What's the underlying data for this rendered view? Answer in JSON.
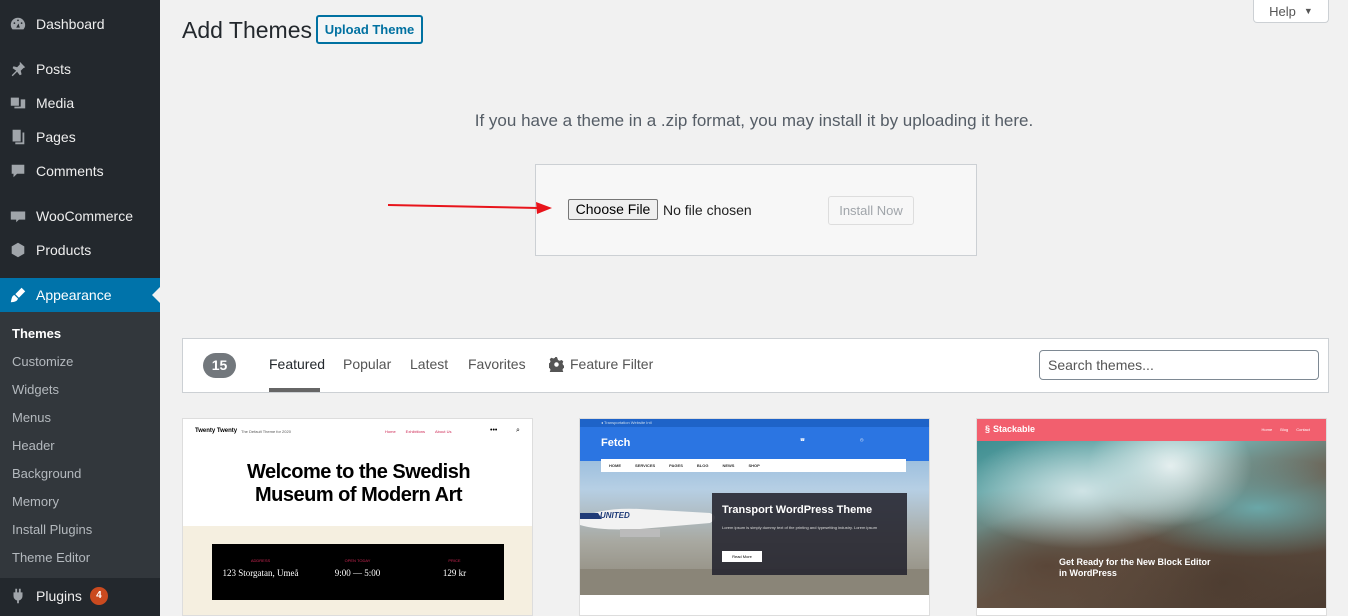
{
  "sidebar": {
    "items": [
      {
        "label": "Dashboard",
        "icon": "dashboard-icon"
      },
      {
        "label": "Posts",
        "icon": "pin-icon"
      },
      {
        "label": "Media",
        "icon": "media-icon"
      },
      {
        "label": "Pages",
        "icon": "pages-icon"
      },
      {
        "label": "Comments",
        "icon": "comments-icon"
      },
      {
        "label": "WooCommerce",
        "icon": "woocommerce-icon"
      },
      {
        "label": "Products",
        "icon": "products-icon"
      },
      {
        "label": "Appearance",
        "icon": "appearance-brush-icon"
      }
    ],
    "submenu": [
      "Themes",
      "Customize",
      "Widgets",
      "Menus",
      "Header",
      "Background",
      "Memory",
      "Install Plugins",
      "Theme Editor"
    ],
    "plugins": {
      "label": "Plugins",
      "badge": "4"
    }
  },
  "header": {
    "title": "Add Themes",
    "upload_button": "Upload Theme",
    "help": "Help"
  },
  "upload": {
    "description": "If you have a theme in a .zip format, you may install it by uploading it here.",
    "choose_file": "Choose File",
    "no_file": "No file chosen",
    "install_now": "Install Now"
  },
  "filter": {
    "count": "15",
    "tabs": [
      "Featured",
      "Popular",
      "Latest",
      "Favorites"
    ],
    "feature_filter": "Feature Filter",
    "search_placeholder": "Search themes..."
  },
  "themes": {
    "twenty_twenty": {
      "site_name": "Twenty Twenty",
      "tagline": "The Default Theme for 2020",
      "nav": [
        "Home",
        "Exhibitions",
        "About Us"
      ],
      "menu": "•••",
      "title_line1": "Welcome to the Swedish",
      "title_line2": "Museum of Modern Art",
      "info": [
        {
          "key": "ADDRESS",
          "value": "123 Storgatan, Umeå"
        },
        {
          "key": "OPEN TODAY",
          "value": "9:00 — 5:00"
        },
        {
          "key": "PRICE",
          "value": "129 kr"
        }
      ]
    },
    "fetch": {
      "topline": "◂ Transportation Website Intl",
      "logo": "Fetch",
      "nav": [
        "HOME",
        "SERVICES",
        "PAGES",
        "BLOG",
        "NEWS",
        "SHOP"
      ],
      "overlay_title": "Transport WordPress Theme",
      "overlay_text": "Lorem ipsum is simply dummy text of the printing and typesetting industry. Lorem ipsum",
      "overlay_button": "Read More",
      "plane_text": "UNITED"
    },
    "stackable": {
      "logo": "Stackable",
      "nav": [
        "Home",
        "Blog",
        "Contact"
      ],
      "headline_line1": "Get Ready for the New Block Editor",
      "headline_line2": "in WordPress"
    }
  },
  "colors": {
    "sidebar_bg": "#23282d",
    "accent": "#0073aa",
    "badge": "#ca4a1f",
    "arrow": "#e8141b"
  }
}
